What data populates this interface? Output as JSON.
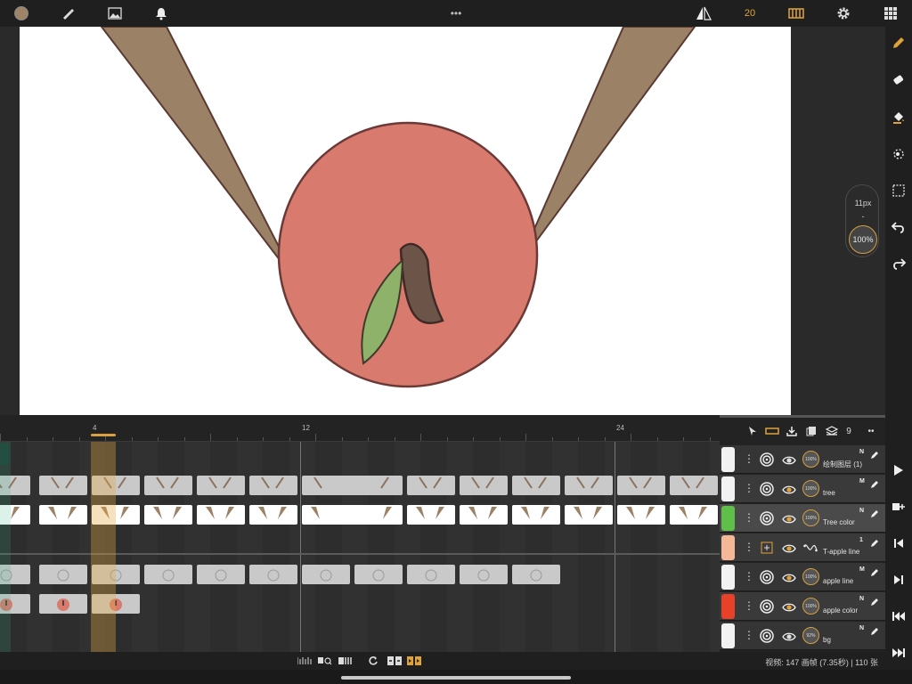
{
  "top_bar": {
    "current_color": "#a08468",
    "more_label": "•••",
    "fps": "20",
    "accent": "#e0a33a"
  },
  "brush": {
    "size": "11px",
    "separator": "-",
    "opacity": "100%"
  },
  "timeline": {
    "ruler_labels": [
      {
        "frame": "4"
      },
      {
        "frame": "12"
      },
      {
        "frame": "24"
      }
    ],
    "current_frame": "4"
  },
  "layers_panel": {
    "tools": {
      "count": "9",
      "more": "••"
    },
    "layers": [
      {
        "name": "绘制图层 (1)",
        "mode": "N",
        "opacity": "100%",
        "color": "#f2f2f2"
      },
      {
        "name": "tree",
        "mode": "M",
        "opacity": "100%",
        "color": "#f2f2f2"
      },
      {
        "name": "Tree color",
        "mode": "N",
        "opacity": "100%",
        "color": "#5fbf4a"
      },
      {
        "name": "T-apple line",
        "mode": "1",
        "opacity": "",
        "color": "#f5b896"
      },
      {
        "name": "apple line",
        "mode": "M",
        "opacity": "100%",
        "color": "#f2f2f2"
      },
      {
        "name": "apple color",
        "mode": "N",
        "opacity": "100%",
        "color": "#e8412a"
      },
      {
        "name": "bg",
        "mode": "N",
        "opacity": "92%",
        "color": "#f2f2f2"
      }
    ]
  },
  "status": {
    "text": "视频: 147 画帧 (7.35秒) | 110 张"
  }
}
